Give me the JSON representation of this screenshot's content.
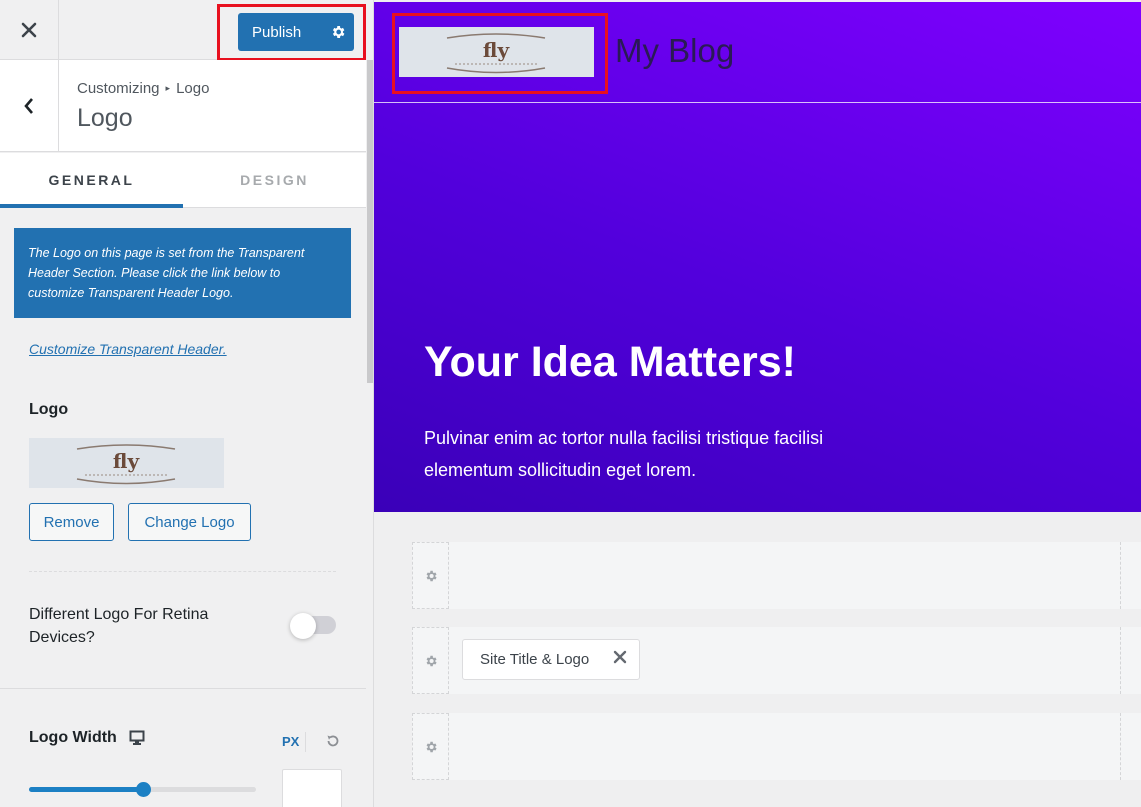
{
  "topbar": {
    "close_label": "Close",
    "publish_label": "Publish"
  },
  "section": {
    "breadcrumb_root": "Customizing",
    "breadcrumb_separator": "▸",
    "breadcrumb_current": "Logo",
    "title": "Logo"
  },
  "tabs": [
    {
      "label": "GENERAL",
      "active": true
    },
    {
      "label": "DESIGN",
      "active": false
    }
  ],
  "notice": {
    "text": "The Logo on this page is set from the Transparent Header Section. Please click the link below to customize Transparent Header Logo."
  },
  "link": {
    "label": "Customize Transparent Header."
  },
  "logo_field": {
    "label": "Logo",
    "image_text": "fly",
    "remove_label": "Remove",
    "change_label": "Change Logo"
  },
  "retina": {
    "label": "Different Logo For Retina Devices?",
    "enabled": false
  },
  "logo_width": {
    "label": "Logo Width",
    "unit": "PX",
    "slider_fraction": 0.5,
    "value": ""
  },
  "preview": {
    "site_title": "My Blog",
    "logo_text": "fly",
    "hero_title": "Your Idea Matters!",
    "hero_text": "Pulvinar enim ac tortor nulla facilisi tristique facilisi elementum sollicitudin eget lorem.",
    "rows": [
      {
        "items": []
      },
      {
        "items": [
          {
            "label": "Site Title & Logo"
          }
        ]
      },
      {
        "items": []
      }
    ]
  },
  "colors": {
    "accent": "#2271b1",
    "highlight": "#e8101f",
    "hero_gradient_start": "#3a00b8",
    "hero_gradient_end": "#7f00ff"
  }
}
